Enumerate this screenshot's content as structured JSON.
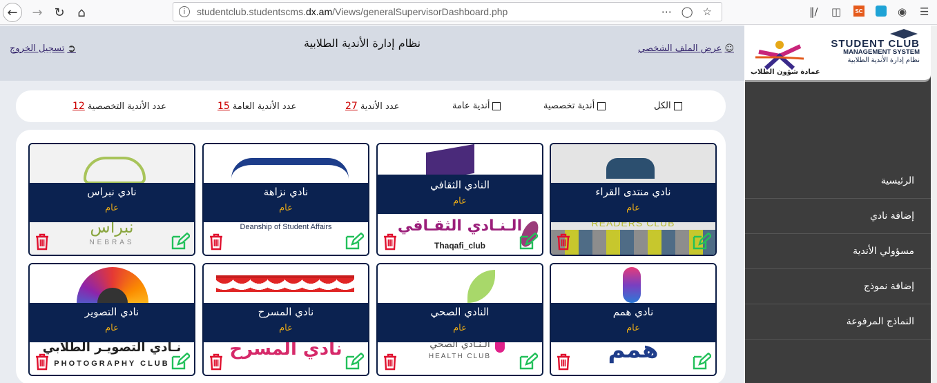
{
  "browser": {
    "url_prefix": "studentclub.studentscms.",
    "url_domain": "dx.am",
    "url_path": "/Views/generalSupervisorDashboard.php",
    "ext_badge": "SC"
  },
  "header": {
    "title": "نظام إدارة الأندية الطلابية",
    "logout_label": "تسجيل الخروج",
    "profile_label": "عرض الملف الشخصي"
  },
  "filters": {
    "all_label": "الكل",
    "specialized_label": "أندية تخصصية",
    "general_label": "أندية عامة",
    "clubs_count_label": "عدد الأندية",
    "clubs_count": "27",
    "general_count_label": "عدد الأندية العامة",
    "general_count": "15",
    "specialized_count_label": "عدد الأندية التخصصية",
    "specialized_count": "12"
  },
  "cards": [
    {
      "name": "نادي منتدى القراء",
      "type": "عام",
      "logo_text": "READERS CLUB"
    },
    {
      "name": "النادي الثقافي",
      "type": "عام",
      "logo_text": "Thaqafi_club"
    },
    {
      "name": "نادي نزاهة",
      "type": "عام",
      "logo_text": "Deanship of Student Affairs"
    },
    {
      "name": "نادي نبراس",
      "type": "عام",
      "logo_text": "NEBRAS"
    },
    {
      "name": "نادي همم",
      "type": "عام",
      "logo_text": "همم"
    },
    {
      "name": "النادي الصحي",
      "type": "عام",
      "logo_text": "HEALTH CLUB"
    },
    {
      "name": "نادي المسرح",
      "type": "عام",
      "logo_text": "نادي المسرح"
    },
    {
      "name": "نادي التصوير",
      "type": "عام",
      "logo_text": "PHOTOGRAPHY CLUB"
    }
  ],
  "sidebar": {
    "logo_line1": "STUDENT CLUB",
    "logo_line2": "MANAGEMENT SYSTEM",
    "logo_line3": "نظام إدارة الأندية الطلابية",
    "logo_ar": "عمادة شؤون الطلاب",
    "items": [
      {
        "label": "الرئيسية"
      },
      {
        "label": "إضافة نادي"
      },
      {
        "label": "مسؤولي الأندية"
      },
      {
        "label": "إضافة نموذج"
      },
      {
        "label": "النماذج المرفوعة"
      }
    ]
  },
  "colors": {
    "header_bg": "#d6dbe4",
    "sidebar_bg": "#3d3d3d",
    "card_band": "#0b2250",
    "type_color": "#e6a817",
    "count_color": "#c00000",
    "trash_color": "#e0102e",
    "edit_color": "#22c05a"
  }
}
